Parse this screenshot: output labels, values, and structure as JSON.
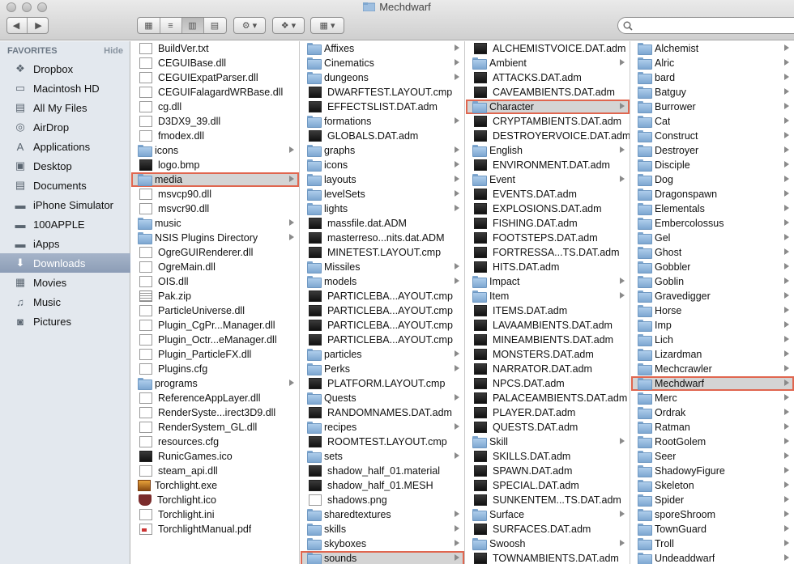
{
  "window": {
    "title": "Mechdwarf",
    "search_placeholder": ""
  },
  "toolbar": {
    "back_icon": "chevron-left-icon",
    "forward_icon": "chevron-right-icon",
    "view_modes": [
      "icon-view",
      "list-view",
      "column-view",
      "cover-flow-view"
    ],
    "active_view": "column-view",
    "action_icon": "gear-icon",
    "dropbox_icon": "dropbox-icon",
    "arrange_icon": "arrange-icon"
  },
  "sidebar": {
    "heading": "FAVORITES",
    "hide_label": "Hide",
    "items": [
      {
        "label": "Dropbox",
        "icon": "dropbox-icon"
      },
      {
        "label": "Macintosh HD",
        "icon": "hard-drive-icon"
      },
      {
        "label": "All My Files",
        "icon": "all-files-icon"
      },
      {
        "label": "AirDrop",
        "icon": "airdrop-icon"
      },
      {
        "label": "Applications",
        "icon": "applications-icon"
      },
      {
        "label": "Desktop",
        "icon": "desktop-icon"
      },
      {
        "label": "Documents",
        "icon": "documents-icon"
      },
      {
        "label": "iPhone Simulator",
        "icon": "folder-icon"
      },
      {
        "label": "100APPLE",
        "icon": "folder-icon"
      },
      {
        "label": "iApps",
        "icon": "folder-icon"
      },
      {
        "label": "Downloads",
        "icon": "downloads-icon",
        "selected": true
      },
      {
        "label": "Movies",
        "icon": "movies-icon"
      },
      {
        "label": "Music",
        "icon": "music-icon"
      },
      {
        "label": "Pictures",
        "icon": "pictures-icon"
      }
    ]
  },
  "columns": [
    {
      "items": [
        {
          "name": "BuildVer.txt",
          "kind": "doc"
        },
        {
          "name": "CEGUIBase.dll",
          "kind": "doc"
        },
        {
          "name": "CEGUIExpatParser.dll",
          "kind": "doc"
        },
        {
          "name": "CEGUIFalagardWRBase.dll",
          "kind": "doc"
        },
        {
          "name": "cg.dll",
          "kind": "doc"
        },
        {
          "name": "D3DX9_39.dll",
          "kind": "doc"
        },
        {
          "name": "fmodex.dll",
          "kind": "doc"
        },
        {
          "name": "icons",
          "kind": "folder"
        },
        {
          "name": "logo.bmp",
          "kind": "docdark"
        },
        {
          "name": "media",
          "kind": "folder",
          "selected": true
        },
        {
          "name": "msvcp90.dll",
          "kind": "doc"
        },
        {
          "name": "msvcr90.dll",
          "kind": "doc"
        },
        {
          "name": "music",
          "kind": "folder"
        },
        {
          "name": "NSIS Plugins Directory",
          "kind": "folder"
        },
        {
          "name": "OgreGUIRenderer.dll",
          "kind": "doc"
        },
        {
          "name": "OgreMain.dll",
          "kind": "doc"
        },
        {
          "name": "OIS.dll",
          "kind": "doc"
        },
        {
          "name": "Pak.zip",
          "kind": "zip"
        },
        {
          "name": "ParticleUniverse.dll",
          "kind": "doc"
        },
        {
          "name": "Plugin_CgPr...Manager.dll",
          "kind": "doc"
        },
        {
          "name": "Plugin_Octr...eManager.dll",
          "kind": "doc"
        },
        {
          "name": "Plugin_ParticleFX.dll",
          "kind": "doc"
        },
        {
          "name": "Plugins.cfg",
          "kind": "doc"
        },
        {
          "name": "programs",
          "kind": "folder"
        },
        {
          "name": "ReferenceAppLayer.dll",
          "kind": "doc"
        },
        {
          "name": "RenderSyste...irect3D9.dll",
          "kind": "doc"
        },
        {
          "name": "RenderSystem_GL.dll",
          "kind": "doc"
        },
        {
          "name": "resources.cfg",
          "kind": "doc"
        },
        {
          "name": "RunicGames.ico",
          "kind": "docdark"
        },
        {
          "name": "steam_api.dll",
          "kind": "doc"
        },
        {
          "name": "Torchlight.exe",
          "kind": "img"
        },
        {
          "name": "Torchlight.ico",
          "kind": "shield"
        },
        {
          "name": "Torchlight.ini",
          "kind": "doc"
        },
        {
          "name": "TorchlightManual.pdf",
          "kind": "pdf"
        }
      ]
    },
    {
      "items": [
        {
          "name": "Affixes",
          "kind": "folder"
        },
        {
          "name": "Cinematics",
          "kind": "folder"
        },
        {
          "name": "dungeons",
          "kind": "folder"
        },
        {
          "name": "DWARFTEST.LAYOUT.cmp",
          "kind": "docdark"
        },
        {
          "name": "EFFECTSLIST.DAT.adm",
          "kind": "docdark"
        },
        {
          "name": "formations",
          "kind": "folder"
        },
        {
          "name": "GLOBALS.DAT.adm",
          "kind": "docdark"
        },
        {
          "name": "graphs",
          "kind": "folder"
        },
        {
          "name": "icons",
          "kind": "folder"
        },
        {
          "name": "layouts",
          "kind": "folder"
        },
        {
          "name": "levelSets",
          "kind": "folder"
        },
        {
          "name": "lights",
          "kind": "folder"
        },
        {
          "name": "massfile.dat.ADM",
          "kind": "docdark"
        },
        {
          "name": "masterreso...nits.dat.ADM",
          "kind": "docdark"
        },
        {
          "name": "MINETEST.LAYOUT.cmp",
          "kind": "docdark"
        },
        {
          "name": "Missiles",
          "kind": "folder"
        },
        {
          "name": "models",
          "kind": "folder"
        },
        {
          "name": "PARTICLEBA...AYOUT.cmp",
          "kind": "docdark"
        },
        {
          "name": "PARTICLEBA...AYOUT.cmp",
          "kind": "docdark"
        },
        {
          "name": "PARTICLEBA...AYOUT.cmp",
          "kind": "docdark"
        },
        {
          "name": "PARTICLEBA...AYOUT.cmp",
          "kind": "docdark"
        },
        {
          "name": "particles",
          "kind": "folder"
        },
        {
          "name": "Perks",
          "kind": "folder"
        },
        {
          "name": "PLATFORM.LAYOUT.cmp",
          "kind": "docdark"
        },
        {
          "name": "Quests",
          "kind": "folder"
        },
        {
          "name": "RANDOMNAMES.DAT.adm",
          "kind": "docdark"
        },
        {
          "name": "recipes",
          "kind": "folder"
        },
        {
          "name": "ROOMTEST.LAYOUT.cmp",
          "kind": "docdark"
        },
        {
          "name": "sets",
          "kind": "folder"
        },
        {
          "name": "shadow_half_01.material",
          "kind": "docdark"
        },
        {
          "name": "shadow_half_01.MESH",
          "kind": "docdark"
        },
        {
          "name": "shadows.png",
          "kind": "doc"
        },
        {
          "name": "sharedtextures",
          "kind": "folder"
        },
        {
          "name": "skills",
          "kind": "folder"
        },
        {
          "name": "skyboxes",
          "kind": "folder"
        },
        {
          "name": "sounds",
          "kind": "folder",
          "selected": true
        }
      ]
    },
    {
      "items": [
        {
          "name": "ALCHEMISTVOICE.DAT.adm",
          "kind": "docdark"
        },
        {
          "name": "Ambient",
          "kind": "folder"
        },
        {
          "name": "ATTACKS.DAT.adm",
          "kind": "docdark"
        },
        {
          "name": "CAVEAMBIENTS.DAT.adm",
          "kind": "docdark"
        },
        {
          "name": "Character",
          "kind": "folder",
          "selected": true
        },
        {
          "name": "CRYPTAMBIENTS.DAT.adm",
          "kind": "docdark"
        },
        {
          "name": "DESTROYERVOICE.DAT.adm",
          "kind": "docdark"
        },
        {
          "name": "English",
          "kind": "folder"
        },
        {
          "name": "ENVIRONMENT.DAT.adm",
          "kind": "docdark"
        },
        {
          "name": "Event",
          "kind": "folder"
        },
        {
          "name": "EVENTS.DAT.adm",
          "kind": "docdark"
        },
        {
          "name": "EXPLOSIONS.DAT.adm",
          "kind": "docdark"
        },
        {
          "name": "FISHING.DAT.adm",
          "kind": "docdark"
        },
        {
          "name": "FOOTSTEPS.DAT.adm",
          "kind": "docdark"
        },
        {
          "name": "FORTRESSA...TS.DAT.adm",
          "kind": "docdark"
        },
        {
          "name": "HITS.DAT.adm",
          "kind": "docdark"
        },
        {
          "name": "Impact",
          "kind": "folder"
        },
        {
          "name": "Item",
          "kind": "folder"
        },
        {
          "name": "ITEMS.DAT.adm",
          "kind": "docdark"
        },
        {
          "name": "LAVAAMBIENTS.DAT.adm",
          "kind": "docdark"
        },
        {
          "name": "MINEAMBIENTS.DAT.adm",
          "kind": "docdark"
        },
        {
          "name": "MONSTERS.DAT.adm",
          "kind": "docdark"
        },
        {
          "name": "NARRATOR.DAT.adm",
          "kind": "docdark"
        },
        {
          "name": "NPCS.DAT.adm",
          "kind": "docdark"
        },
        {
          "name": "PALACEAMBIENTS.DAT.adm",
          "kind": "docdark"
        },
        {
          "name": "PLAYER.DAT.adm",
          "kind": "docdark"
        },
        {
          "name": "QUESTS.DAT.adm",
          "kind": "docdark"
        },
        {
          "name": "Skill",
          "kind": "folder"
        },
        {
          "name": "SKILLS.DAT.adm",
          "kind": "docdark"
        },
        {
          "name": "SPAWN.DAT.adm",
          "kind": "docdark"
        },
        {
          "name": "SPECIAL.DAT.adm",
          "kind": "docdark"
        },
        {
          "name": "SUNKENTEM...TS.DAT.adm",
          "kind": "docdark"
        },
        {
          "name": "Surface",
          "kind": "folder"
        },
        {
          "name": "SURFACES.DAT.adm",
          "kind": "docdark"
        },
        {
          "name": "Swoosh",
          "kind": "folder"
        },
        {
          "name": "TOWNAMBIENTS.DAT.adm",
          "kind": "docdark"
        }
      ]
    },
    {
      "items": [
        {
          "name": "Alchemist",
          "kind": "folder"
        },
        {
          "name": "Alric",
          "kind": "folder"
        },
        {
          "name": "bard",
          "kind": "folder"
        },
        {
          "name": "Batguy",
          "kind": "folder"
        },
        {
          "name": "Burrower",
          "kind": "folder"
        },
        {
          "name": "Cat",
          "kind": "folder"
        },
        {
          "name": "Construct",
          "kind": "folder"
        },
        {
          "name": "Destroyer",
          "kind": "folder"
        },
        {
          "name": "Disciple",
          "kind": "folder"
        },
        {
          "name": "Dog",
          "kind": "folder"
        },
        {
          "name": "Dragonspawn",
          "kind": "folder"
        },
        {
          "name": "Elementals",
          "kind": "folder"
        },
        {
          "name": "Embercolossus",
          "kind": "folder"
        },
        {
          "name": "Gel",
          "kind": "folder"
        },
        {
          "name": "Ghost",
          "kind": "folder"
        },
        {
          "name": "Gobbler",
          "kind": "folder"
        },
        {
          "name": "Goblin",
          "kind": "folder"
        },
        {
          "name": "Gravedigger",
          "kind": "folder"
        },
        {
          "name": "Horse",
          "kind": "folder"
        },
        {
          "name": "Imp",
          "kind": "folder"
        },
        {
          "name": "Lich",
          "kind": "folder"
        },
        {
          "name": "Lizardman",
          "kind": "folder"
        },
        {
          "name": "Mechcrawler",
          "kind": "folder"
        },
        {
          "name": "Mechdwarf",
          "kind": "folder",
          "selected": true
        },
        {
          "name": "Merc",
          "kind": "folder"
        },
        {
          "name": "Ordrak",
          "kind": "folder"
        },
        {
          "name": "Ratman",
          "kind": "folder"
        },
        {
          "name": "RootGolem",
          "kind": "folder"
        },
        {
          "name": "Seer",
          "kind": "folder"
        },
        {
          "name": "ShadowyFigure",
          "kind": "folder"
        },
        {
          "name": "Skeleton",
          "kind": "folder"
        },
        {
          "name": "Spider",
          "kind": "folder"
        },
        {
          "name": "sporeShroom",
          "kind": "folder"
        },
        {
          "name": "TownGuard",
          "kind": "folder"
        },
        {
          "name": "Troll",
          "kind": "folder"
        },
        {
          "name": "Undeaddwarf",
          "kind": "folder"
        }
      ]
    }
  ],
  "colors": {
    "selection_outline": "#e0664f",
    "selection_fill": "#d4d4d4",
    "sidebar_bg": "#e3e8ee",
    "sidebar_selected": "#8c9db6"
  }
}
